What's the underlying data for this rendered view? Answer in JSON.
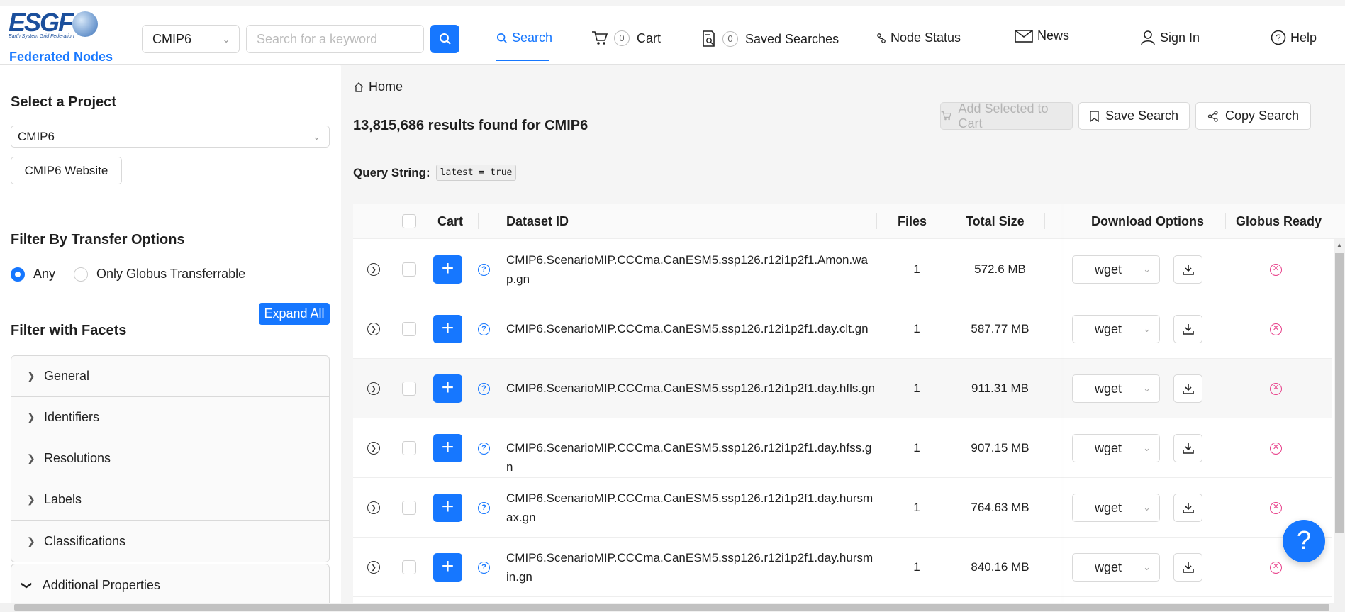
{
  "logo": {
    "text": "ESGF",
    "subtitle": "Earth System Grid Federation"
  },
  "header": {
    "federated_nodes": "Federated Nodes",
    "project_select": "CMIP6",
    "search_placeholder": "Search for a keyword",
    "nav": {
      "search": "Search",
      "cart": "Cart",
      "cart_count": "0",
      "saved_searches": "Saved Searches",
      "saved_count": "0",
      "node_status": "Node Status",
      "news": "News",
      "sign_in": "Sign In",
      "help": "Help"
    }
  },
  "sidebar": {
    "select_project_heading": "Select a Project",
    "project_value": "CMIP6",
    "website_button": "CMIP6 Website",
    "transfer_heading": "Filter By Transfer Options",
    "radio_any": "Any",
    "radio_globus": "Only Globus Transferrable",
    "radio_selected": "Any",
    "expand_all": "Expand All",
    "facets_heading": "Filter with Facets",
    "facets": [
      "General",
      "Identifiers",
      "Resolutions",
      "Labels",
      "Classifications"
    ],
    "additional_properties": "Additional Properties"
  },
  "main": {
    "breadcrumb": "Home",
    "results_text": "13,815,686 results found for CMIP6",
    "add_to_cart": "Add Selected to Cart",
    "save_search": "Save Search",
    "copy_search": "Copy Search",
    "query_label": "Query String:",
    "query_value": "latest = true"
  },
  "table": {
    "headers": {
      "cart": "Cart",
      "dataset_id": "Dataset ID",
      "files": "Files",
      "total_size": "Total Size",
      "download_options": "Download Options",
      "globus_ready": "Globus Ready"
    },
    "rows": [
      {
        "dataset_id": "CMIP6.ScenarioMIP.CCCma.CanESM5.ssp126.r12i1p2f1.Amon.wap.gn",
        "files": "1",
        "size": "572.6 MB",
        "download": "wget"
      },
      {
        "dataset_id": "CMIP6.ScenarioMIP.CCCma.CanESM5.ssp126.r12i1p2f1.day.clt.gn",
        "files": "1",
        "size": "587.77 MB",
        "download": "wget"
      },
      {
        "dataset_id": "CMIP6.ScenarioMIP.CCCma.CanESM5.ssp126.r12i1p2f1.day.hfls.gn",
        "files": "1",
        "size": "911.31 MB",
        "download": "wget"
      },
      {
        "dataset_id": "CMIP6.ScenarioMIP.CCCma.CanESM5.ssp126.r12i1p2f1.day.hfss.gn",
        "files": "1",
        "size": "907.15 MB",
        "download": "wget"
      },
      {
        "dataset_id": "CMIP6.ScenarioMIP.CCCma.CanESM5.ssp126.r12i1p2f1.day.hursmax.gn",
        "files": "1",
        "size": "764.63 MB",
        "download": "wget"
      },
      {
        "dataset_id": "CMIP6.ScenarioMIP.CCCma.CanESM5.ssp126.r12i1p2f1.day.hursmin.gn",
        "files": "1",
        "size": "840.16 MB",
        "download": "wget"
      }
    ]
  },
  "colors": {
    "primary": "#1677ff",
    "globus_not_ready": "#e8408a",
    "brand": "#1b4f9c"
  },
  "icons": [
    "search-icon",
    "cart-icon",
    "saved-search-icon",
    "node-status-icon",
    "mail-icon",
    "user-icon",
    "help-icon",
    "home-icon",
    "bookmark-icon",
    "share-icon",
    "download-icon",
    "expand-row-icon",
    "info-icon",
    "not-ready-icon"
  ]
}
